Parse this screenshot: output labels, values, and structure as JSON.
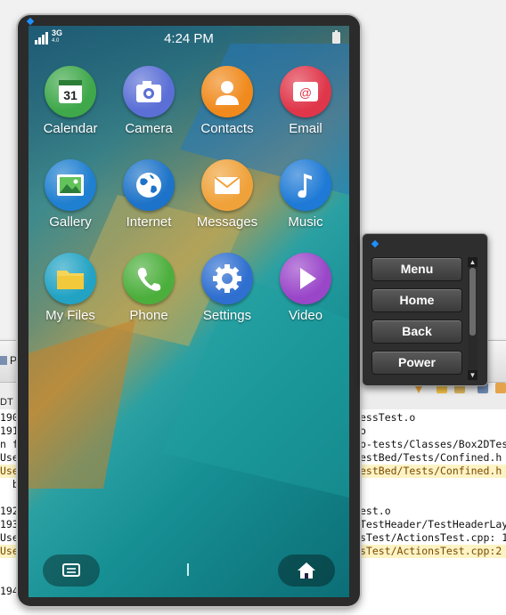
{
  "ide": {
    "tab_label": "Pr",
    "column_header": "DT",
    "lines_left": [
      "190",
      "191",
      "n f",
      "Use",
      "Use",
      "  b",
      "",
      "192",
      "193",
      "Use",
      "Use",
      "",
      "",
      "194"
    ],
    "lines_right": [
      "essTest.o",
      "o",
      "p-tests/Classes/Box2DTes",
      "estBed/Tests/Confined.h",
      "estBed/Tests/Confined.h",
      "",
      "",
      "est.o",
      "TestHeader/TestHeaderLay",
      "sTest/ActionsTest.cpp: 1",
      "sTest/ActionsTest.cpp:2",
      "",
      "",
      ""
    ]
  },
  "phone": {
    "status": {
      "time": "4:24 PM",
      "network": "3G",
      "network_sub": "4.0"
    },
    "apps": [
      {
        "label": "Calendar",
        "icon": "calendar-icon",
        "day": "31",
        "color": "#3fa84a"
      },
      {
        "label": "Camera",
        "icon": "camera-icon",
        "color": "#5b6fd6"
      },
      {
        "label": "Contacts",
        "icon": "contacts-icon",
        "color": "#f08a1c"
      },
      {
        "label": "Email",
        "icon": "email-icon",
        "color": "#e0364a"
      },
      {
        "label": "Gallery",
        "icon": "gallery-icon",
        "color": "#1f7fd0"
      },
      {
        "label": "Internet",
        "icon": "globe-icon",
        "color": "#1d73c9"
      },
      {
        "label": "Messages",
        "icon": "messages-icon",
        "color": "#f0a23a"
      },
      {
        "label": "Music",
        "icon": "music-icon",
        "color": "#1e7ad6"
      },
      {
        "label": "My Files",
        "icon": "folder-icon",
        "color": "#22a3c4"
      },
      {
        "label": "Phone",
        "icon": "phone-icon",
        "color": "#4caf3c"
      },
      {
        "label": "Settings",
        "icon": "gear-icon",
        "color": "#2f6fd0"
      },
      {
        "label": "Video",
        "icon": "play-icon",
        "color": "#9a46c9"
      }
    ]
  },
  "panel": {
    "buttons": [
      "Menu",
      "Home",
      "Back",
      "Power"
    ]
  }
}
